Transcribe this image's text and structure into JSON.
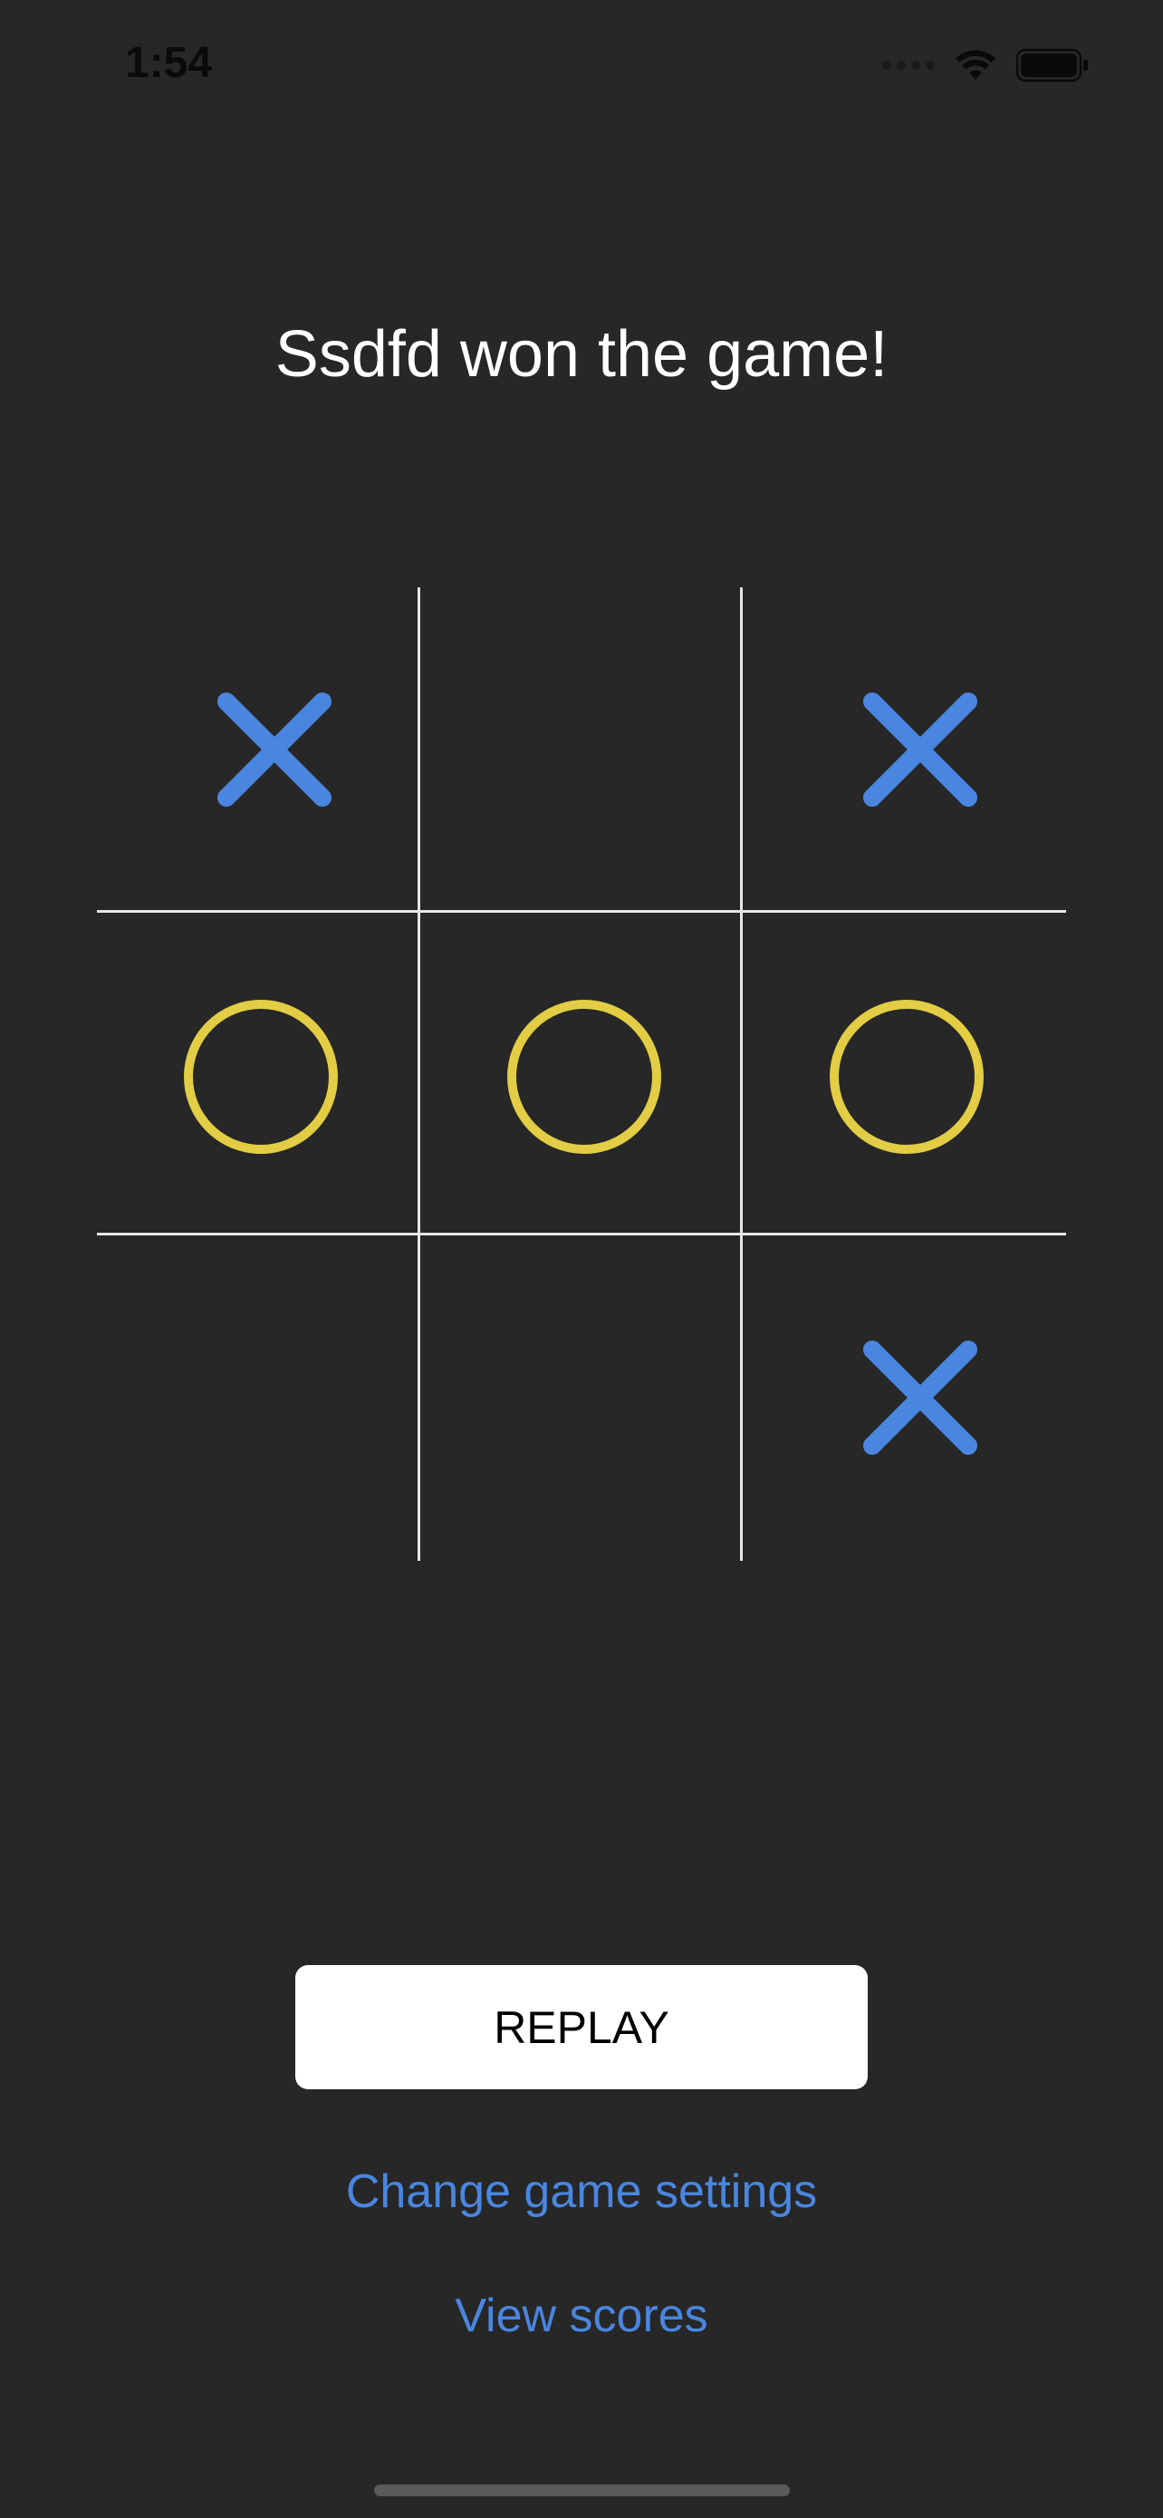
{
  "status_bar": {
    "time": "1:54"
  },
  "game": {
    "result_text": "Ssdfd won the game!",
    "board": [
      [
        "X",
        "",
        "X"
      ],
      [
        "O",
        "O",
        "O"
      ],
      [
        "",
        "",
        "X"
      ]
    ]
  },
  "actions": {
    "replay_label": "REPLAY",
    "settings_label": "Change game settings",
    "scores_label": "View scores"
  },
  "colors": {
    "background": "#272727",
    "x_mark": "#4a86e0",
    "o_mark": "#e2cd45",
    "link": "#4a86e0",
    "grid": "#e6e6e6"
  }
}
